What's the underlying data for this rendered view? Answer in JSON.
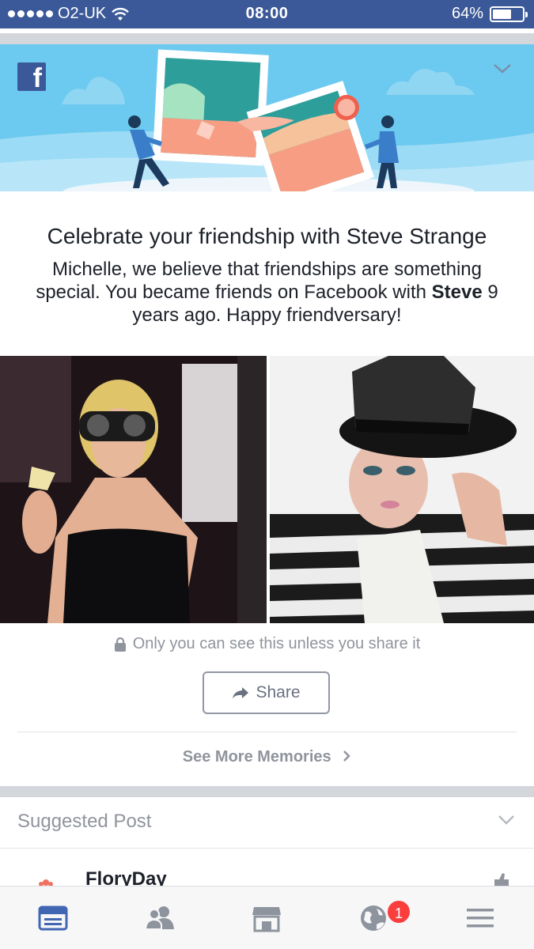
{
  "status_bar": {
    "carrier": "O2-UK",
    "time": "08:00",
    "battery_percent": "64%",
    "battery_level": 0.64
  },
  "memory_card": {
    "headline": "Celebrate your friendship with Steve Strange",
    "body_line_1": "Michelle, we believe that friendships are something special. You became friends on Facebook with ",
    "body_bold_name": "Steve",
    "body_line_2": " 9 years ago. Happy friendversary!",
    "privacy_note": "Only you can see this unless you share it",
    "share_label": "Share",
    "see_more_label": "See More Memories"
  },
  "suggested_post": {
    "header": "Suggested Post",
    "page_name": "FloryDay"
  },
  "tab_bar": {
    "tabs": [
      "news-feed-icon",
      "friends-icon",
      "marketplace-icon",
      "notifications-globe-icon",
      "menu-icon"
    ],
    "notification_count": "1",
    "active_color": "#4267b2",
    "inactive_color": "#8d949e"
  }
}
